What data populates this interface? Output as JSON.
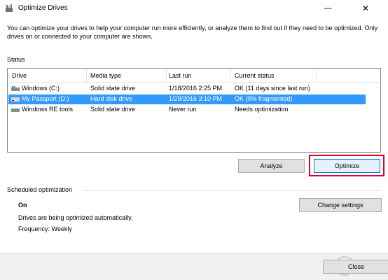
{
  "window": {
    "title": "Optimize Drives",
    "minimize_glyph": "—",
    "close_glyph": "✕"
  },
  "intro_text": "You can optimize your drives to help your computer run more efficiently, or analyze them to find out if they need to be optimized. Only drives on or connected to your computer are shown.",
  "status": {
    "label": "Status",
    "columns": [
      "Drive",
      "Media type",
      "Last run",
      "Current status"
    ],
    "rows": [
      {
        "drive": "Windows (C:)",
        "media_type": "Solid state drive",
        "last_run": "1/18/2016 2:25 PM",
        "current_status": "OK (11 days since last run)",
        "selected": false,
        "icon": "windows-drive-icon"
      },
      {
        "drive": "My Passport (D:)",
        "media_type": "Hard disk drive",
        "last_run": "1/29/2016 3:10 PM",
        "current_status": "OK (0% fragmented)",
        "selected": true,
        "icon": "external-drive-icon"
      },
      {
        "drive": "Windows RE tools",
        "media_type": "Solid state drive",
        "last_run": "Never run",
        "current_status": "Needs optimization",
        "selected": false,
        "icon": "drive-icon"
      }
    ]
  },
  "buttons": {
    "analyze": "Analyze",
    "optimize": "Optimize",
    "change_settings": "Change settings",
    "close": "Close"
  },
  "scheduled": {
    "label": "Scheduled optimization",
    "state": "On",
    "description": "Drives are being optimized automatically.",
    "frequency": "Frequency: Weekly"
  },
  "colors": {
    "selection": "#3399ff",
    "highlight_border": "#e00028",
    "accent": "#0078d7"
  }
}
